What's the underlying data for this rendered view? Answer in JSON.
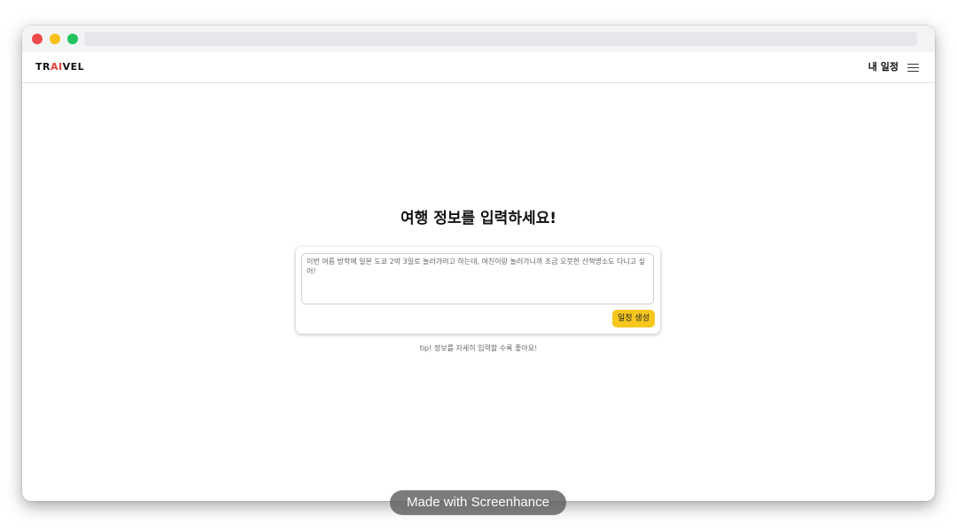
{
  "app": {
    "logo": {
      "prefix": "TR",
      "accent": "AI",
      "suffix": "VEL"
    },
    "colors": {
      "accent_logo": "#e8433c",
      "button": "#f7c71e"
    }
  },
  "navbar": {
    "my_schedule_label": "내 일정",
    "menu_icon": "hamburger-menu-icon"
  },
  "main": {
    "heading": "여행 정보를 입력하세요!",
    "input": {
      "placeholder": "이번 여름 방학에 일본 도쿄 2박 3일로 놀러가려고 하는데, 여친이랑 놀러가니까 조금 오붓한 산책명소도 다니고 싶어!"
    },
    "generate_button": "일정 생성",
    "tip": "tip! 정보를 자세히 입력할 수록 좋아요!"
  },
  "watermark": "Made with Screenhance"
}
